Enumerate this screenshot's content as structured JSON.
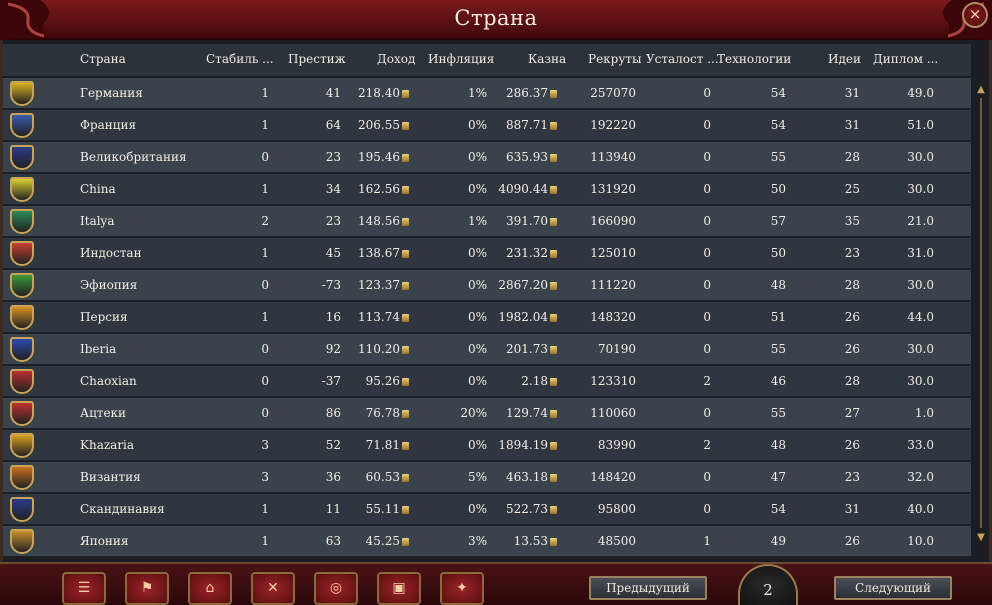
{
  "window": {
    "title": "Страна",
    "close_icon": "×"
  },
  "columns": [
    "Страна",
    "Стабиль ...",
    "Престиж",
    "Доход",
    "Инфляция",
    "Казна",
    "Рекруты",
    "Усталост ...",
    "Технологии",
    "Идеи",
    "Диплом ..."
  ],
  "rows": [
    {
      "shield": "#d8b020",
      "country": "Германия",
      "stab": "1",
      "prest": "41",
      "income": "218.40",
      "infl": "1%",
      "treasury": "286.37",
      "recruits": "257070",
      "war": "0",
      "tech": "54",
      "ideas": "31",
      "dip": "49.0"
    },
    {
      "shield": "#3a5ab0",
      "country": "Франция",
      "stab": "1",
      "prest": "64",
      "income": "206.55",
      "infl": "0%",
      "treasury": "887.71",
      "recruits": "192220",
      "war": "0",
      "tech": "54",
      "ideas": "31",
      "dip": "51.0"
    },
    {
      "shield": "#2a3a8a",
      "country": "Великобритания",
      "stab": "0",
      "prest": "23",
      "income": "195.46",
      "infl": "0%",
      "treasury": "635.93",
      "recruits": "113940",
      "war": "0",
      "tech": "55",
      "ideas": "28",
      "dip": "30.0"
    },
    {
      "shield": "#d8d030",
      "country": "China",
      "stab": "1",
      "prest": "34",
      "income": "162.56",
      "infl": "0%",
      "treasury": "4090.44",
      "recruits": "131920",
      "war": "0",
      "tech": "50",
      "ideas": "25",
      "dip": "30.0"
    },
    {
      "shield": "#2a8a5a",
      "country": "Italya",
      "stab": "2",
      "prest": "23",
      "income": "148.56",
      "infl": "1%",
      "treasury": "391.70",
      "recruits": "166090",
      "war": "0",
      "tech": "57",
      "ideas": "35",
      "dip": "21.0"
    },
    {
      "shield": "#c84030",
      "country": "Индостан",
      "stab": "1",
      "prest": "45",
      "income": "138.67",
      "infl": "0%",
      "treasury": "231.32",
      "recruits": "125010",
      "war": "0",
      "tech": "50",
      "ideas": "23",
      "dip": "31.0"
    },
    {
      "shield": "#3a9a3a",
      "country": "Эфиопия",
      "stab": "0",
      "prest": "-73",
      "income": "123.37",
      "infl": "0%",
      "treasury": "2867.20",
      "recruits": "111220",
      "war": "0",
      "tech": "48",
      "ideas": "28",
      "dip": "30.0"
    },
    {
      "shield": "#d89020",
      "country": "Персия",
      "stab": "1",
      "prest": "16",
      "income": "113.74",
      "infl": "0%",
      "treasury": "1982.04",
      "recruits": "148320",
      "war": "0",
      "tech": "51",
      "ideas": "26",
      "dip": "44.0"
    },
    {
      "shield": "#2a4ab0",
      "country": "Iberia",
      "stab": "0",
      "prest": "92",
      "income": "110.20",
      "infl": "0%",
      "treasury": "201.73",
      "recruits": "70190",
      "war": "0",
      "tech": "55",
      "ideas": "26",
      "dip": "30.0"
    },
    {
      "shield": "#b83030",
      "country": "Chaoxian",
      "stab": "0",
      "prest": "-37",
      "income": "95.26",
      "infl": "0%",
      "treasury": "2.18",
      "recruits": "123310",
      "war": "2",
      "tech": "46",
      "ideas": "28",
      "dip": "30.0"
    },
    {
      "shield": "#c03030",
      "country": "Ацтеки",
      "stab": "0",
      "prest": "86",
      "income": "76.78",
      "infl": "20%",
      "treasury": "129.74",
      "recruits": "110060",
      "war": "0",
      "tech": "55",
      "ideas": "27",
      "dip": "1.0"
    },
    {
      "shield": "#d8a020",
      "country": "Khazaria",
      "stab": "3",
      "prest": "52",
      "income": "71.81",
      "infl": "0%",
      "treasury": "1894.19",
      "recruits": "83990",
      "war": "2",
      "tech": "48",
      "ideas": "26",
      "dip": "33.0"
    },
    {
      "shield": "#c87020",
      "country": "Византия",
      "stab": "3",
      "prest": "36",
      "income": "60.53",
      "infl": "5%",
      "treasury": "463.18",
      "recruits": "148420",
      "war": "0",
      "tech": "47",
      "ideas": "23",
      "dip": "32.0"
    },
    {
      "shield": "#2a3a90",
      "country": "Скандинавия",
      "stab": "1",
      "prest": "11",
      "income": "55.11",
      "infl": "0%",
      "treasury": "522.73",
      "recruits": "95800",
      "war": "0",
      "tech": "54",
      "ideas": "31",
      "dip": "40.0"
    },
    {
      "shield": "#c89030",
      "country": "Япония",
      "stab": "1",
      "prest": "63",
      "income": "45.25",
      "infl": "3%",
      "treasury": "13.53",
      "recruits": "48500",
      "war": "1",
      "tech": "49",
      "ideas": "26",
      "dip": "10.0"
    }
  ],
  "toolbar": {
    "buttons": [
      {
        "icon": "scroll-icon",
        "glyph": "☰"
      },
      {
        "icon": "flag-icon",
        "glyph": "⚑"
      },
      {
        "icon": "buildings-icon",
        "glyph": "⌂"
      },
      {
        "icon": "crossed-swords-icon",
        "glyph": "✕"
      },
      {
        "icon": "coins-icon",
        "glyph": "◎"
      },
      {
        "icon": "crate-icon",
        "glyph": "▣"
      },
      {
        "icon": "handshake-icon",
        "glyph": "✦"
      }
    ]
  },
  "pager": {
    "prev_label": "Предыдущий",
    "next_label": "Следующий",
    "page": "2"
  }
}
